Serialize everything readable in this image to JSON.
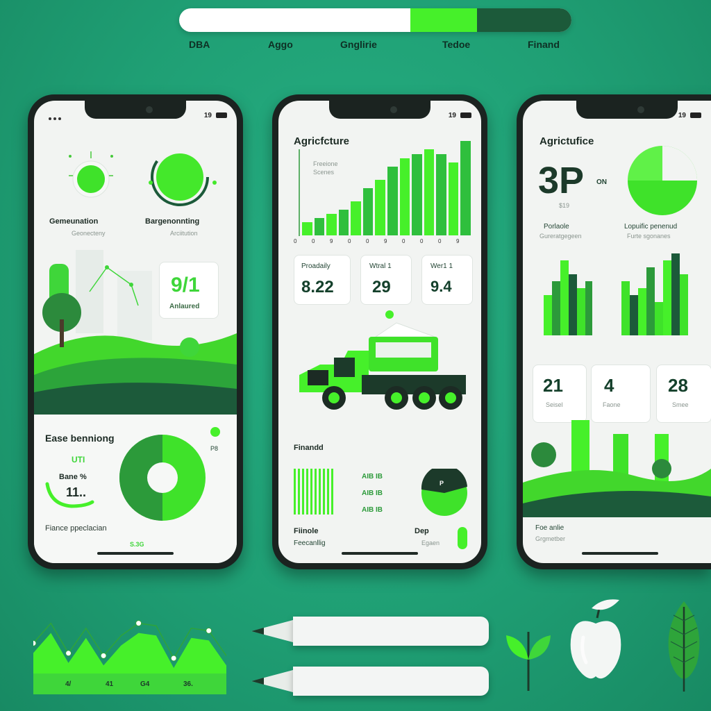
{
  "top_bar": {
    "labels": [
      "DBA",
      "Aggo",
      "Gnglirie",
      "Tedoe",
      "Finand"
    ],
    "progress_start": 0.59,
    "progress_split": 0.76
  },
  "phone1": {
    "status": "19",
    "node_left_label": "Gemeunation",
    "node_left_sub": "Geonecteny",
    "node_right_label": "Bargenonnting",
    "node_right_sub": "Arciitution",
    "stat_value": "9/1",
    "stat_caption": "Anlaured",
    "bottom_title": "Ease benniong",
    "gauge_top": "UTI",
    "gauge_mid": "Bane %",
    "gauge_value": "11..",
    "gauge_marker": "P8",
    "footer_label": "Fiance ppeclacian",
    "footer_value": "S.3G"
  },
  "phone2": {
    "status": "19",
    "title": "Agricfcture",
    "legend_line1": "Freeione",
    "legend_line2": "Scenes",
    "x_ticks": [
      "0",
      "0",
      "9",
      "0",
      "0",
      "9",
      "0",
      "0",
      "0",
      "9"
    ],
    "bar_values": [
      3,
      4,
      5,
      6,
      8,
      11,
      13,
      16,
      18,
      19,
      20,
      19,
      17,
      22
    ],
    "metrics": [
      {
        "label": "Proadaily",
        "value": "8.22"
      },
      {
        "label": "Wtral 1",
        "value": "29"
      },
      {
        "label": "Wer1 1",
        "value": "9.4"
      }
    ],
    "section_label": "Finandd",
    "row_labels": [
      "AIB IB",
      "AIB IB",
      "AIB IB"
    ],
    "pie_marker": "P",
    "footer_left": "Fiinole",
    "footer_left_sub": "Feecanllig",
    "footer_right": "Dep",
    "footer_right_sub": "Egaen"
  },
  "phone3": {
    "status": "19",
    "title": "Agrictufice",
    "big_value": "3P",
    "big_unit": "ON",
    "big_sub": "$19",
    "left_label": "Porlaole",
    "left_sub": "Gureratgegeen",
    "right_label": "Lopuific penenud",
    "right_sub": "Furte sgonanes",
    "stats": [
      {
        "value": "21",
        "label": "Seisel"
      },
      {
        "value": "4",
        "label": "Faone"
      },
      {
        "value": "28",
        "label": "Smee"
      }
    ],
    "footer_label": "Foe anlie",
    "footer_sub": "Grgmetber"
  },
  "line_chart": {
    "points": [
      0.55,
      0.95,
      0.35,
      0.85,
      0.3,
      0.7,
      0.95,
      0.9,
      0.25,
      0.85,
      0.8,
      0.3
    ],
    "x_labels": [
      "4/",
      "41",
      "G4",
      "36."
    ]
  },
  "colors": {
    "accent": "#46f02a",
    "dark_green": "#1c5a3a",
    "mid_green": "#2fbf3d",
    "background": "#1f9f74"
  },
  "icons": [
    "sprout-icon",
    "apple-icon",
    "leaf-icon",
    "pencil-icon",
    "truck-icon"
  ]
}
